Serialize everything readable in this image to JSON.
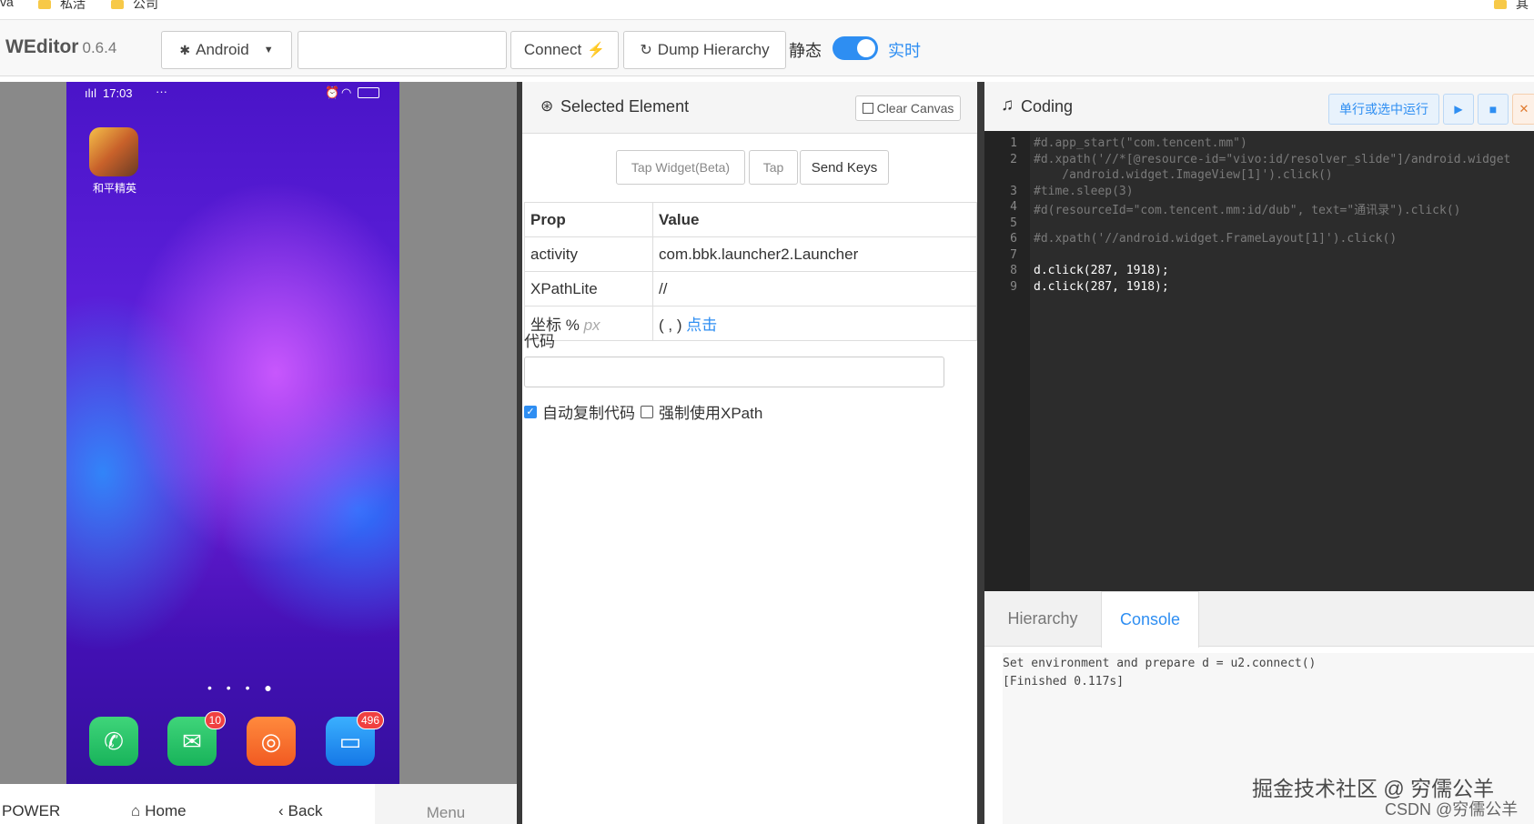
{
  "bookmarks": {
    "items": [
      "va",
      "私活",
      "公司"
    ],
    "right_item": "其"
  },
  "header": {
    "brand": "WEditor",
    "version": "0.6.4",
    "platform_select": "Android",
    "device_input_value": "",
    "connect_label": "Connect",
    "dump_label": "Dump Hierarchy",
    "static_label": "静态",
    "realtime_label": "实时"
  },
  "phone": {
    "time": "17:03",
    "app_label": "和平精英",
    "badges": {
      "wechat": "10",
      "messages": "496"
    },
    "page_dots": "• • • ●"
  },
  "phone_nav": {
    "power": "POWER",
    "home": "Home",
    "back": "Back",
    "menu": "Menu"
  },
  "selected": {
    "title": "Selected Element",
    "clear_canvas": "Clear Canvas",
    "tap_widget": "Tap Widget(Beta)",
    "tap": "Tap",
    "send_keys": "Send Keys",
    "table": {
      "headers": {
        "prop": "Prop",
        "value": "Value"
      },
      "rows": [
        {
          "prop": "activity",
          "value": "com.bbk.launcher2.Launcher"
        },
        {
          "prop": "XPathLite",
          "value": "//"
        }
      ],
      "coord": {
        "label": "坐标 %",
        "unit": "px",
        "value": "( , )",
        "link": "点击"
      }
    },
    "code_label": "代码",
    "code_value": "",
    "auto_copy_label": "自动复制代码",
    "force_xpath_label": "强制使用XPath"
  },
  "coding": {
    "title": "Coding",
    "run_label": "单行或选中运行",
    "lines": [
      {
        "n": "1",
        "text": "#d.app_start(\"com.tencent.mm\")",
        "type": "comment"
      },
      {
        "n": "2",
        "text": "#d.xpath('//*[@resource-id=\"vivo:id/resolver_slide\"]/android.widget",
        "type": "comment"
      },
      {
        "n": "",
        "text": "    /android.widget.ImageView[1]').click()",
        "type": "comment"
      },
      {
        "n": "3",
        "text": "#time.sleep(3)",
        "type": "comment"
      },
      {
        "n": "4",
        "text": "#d(resourceId=\"com.tencent.mm:id/dub\", text=\"通讯录\").click()",
        "type": "comment"
      },
      {
        "n": "5",
        "text": "",
        "type": "comment"
      },
      {
        "n": "6",
        "text": "#d.xpath('//android.widget.FrameLayout[1]').click()",
        "type": "comment"
      },
      {
        "n": "7",
        "text": "",
        "type": "comment"
      },
      {
        "n": "8",
        "text": "d.click(287, 1918);",
        "type": "code"
      },
      {
        "n": "9",
        "text": "d.click(287, 1918);",
        "type": "code"
      }
    ]
  },
  "bottom_tabs": {
    "hierarchy": "Hierarchy",
    "console": "Console"
  },
  "console": {
    "lines": [
      "Set environment and prepare d = u2.connect()",
      "[Finished 0.117s]"
    ]
  },
  "watermark": {
    "main": "掘金技术社区 @ 穷儒公羊",
    "sub": "CSDN @穷儒公羊"
  },
  "colors": {
    "accent": "#2e8ef2",
    "editor_bg": "#2c2c2c"
  }
}
